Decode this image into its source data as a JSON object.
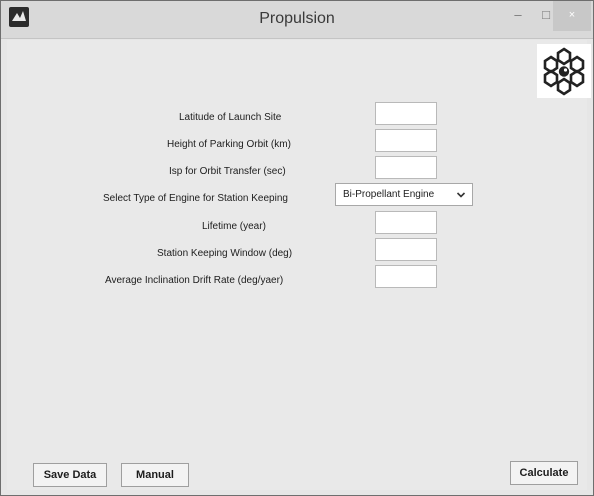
{
  "window": {
    "title": "Propulsion",
    "icon": "matlab-icon",
    "controls": {
      "minimize": "–",
      "maximize": "□",
      "close": "×"
    }
  },
  "logo": {
    "icon": "snowflake-logo-icon"
  },
  "form": {
    "latitude_label": "Latitude of Launch Site",
    "latitude_value": "",
    "parking_orbit_label": "Height of Parking Orbit (km)",
    "parking_orbit_value": "",
    "isp_label": "Isp for Orbit Transfer (sec)",
    "isp_value": "",
    "engine_type_label": "Select Type of Engine for Station Keeping",
    "engine_type_selected": "Bi-Propellant Engine",
    "lifetime_label": "Lifetime (year)",
    "lifetime_value": "",
    "window_label": "Station Keeping Window (deg)",
    "window_value": "",
    "drift_label": "Average Inclination Drift Rate (deg/yaer)",
    "drift_value": ""
  },
  "buttons": {
    "save": "Save Data",
    "manual": "Manual",
    "calculate": "Calculate"
  }
}
